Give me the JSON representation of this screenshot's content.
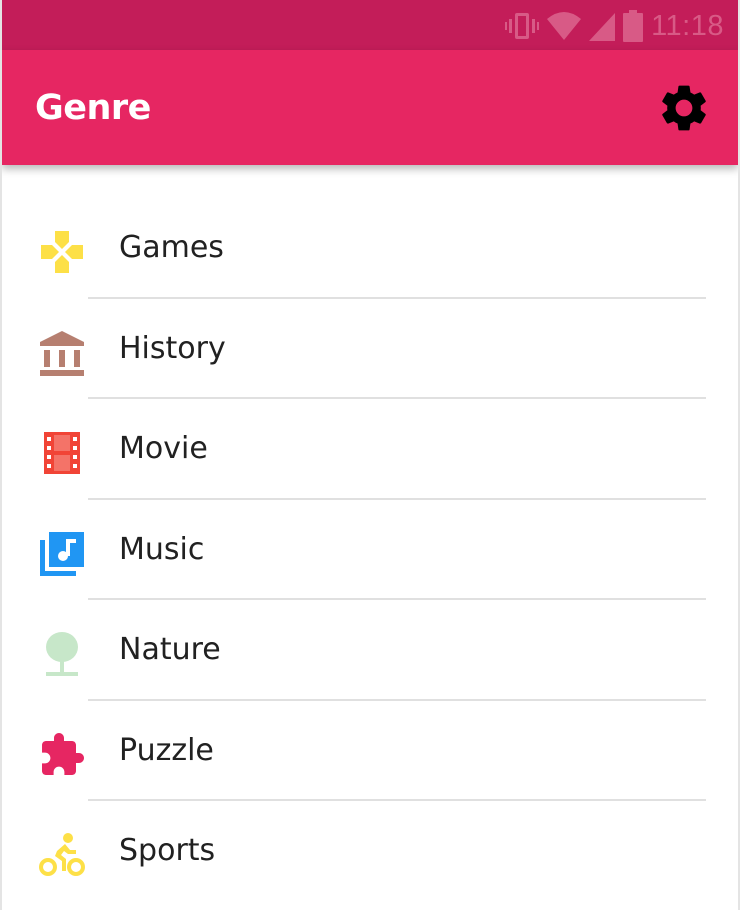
{
  "status_bar": {
    "time": "11:18",
    "icons": [
      "vibrate-icon",
      "wifi-icon",
      "signal-icon",
      "battery-icon"
    ]
  },
  "app_bar": {
    "title": "Genre",
    "settings_icon": "gear-icon",
    "color": "#e62662",
    "status_color": "#c31d59"
  },
  "genres": [
    {
      "label": "Games",
      "icon": "gamepad-icon",
      "color": "#fde047"
    },
    {
      "label": "History",
      "icon": "museum-icon",
      "color": "#b67f70"
    },
    {
      "label": "Movie",
      "icon": "film-icon",
      "color": "#f14436"
    },
    {
      "label": "Music",
      "icon": "music-library-icon",
      "color": "#2096f3"
    },
    {
      "label": "Nature",
      "icon": "tree-icon",
      "color": "#c7e7c9"
    },
    {
      "label": "Puzzle",
      "icon": "puzzle-piece-icon",
      "color": "#e62662"
    },
    {
      "label": "Sports",
      "icon": "bicycle-icon",
      "color": "#fde047"
    }
  ]
}
